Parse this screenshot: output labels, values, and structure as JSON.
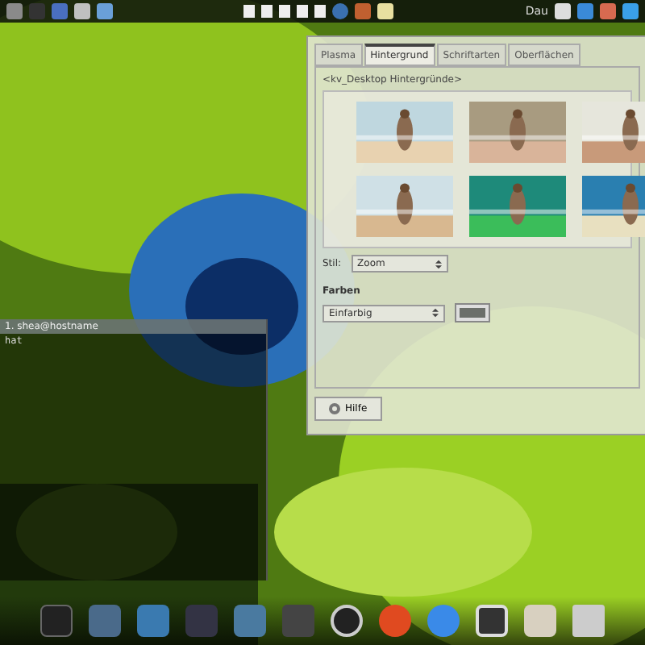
{
  "top_panel": {
    "label": "Dau"
  },
  "settings_window": {
    "tabs": [
      {
        "label": "Plasma",
        "selected": false
      },
      {
        "label": "Hintergrund",
        "selected": true
      },
      {
        "label": "Schriftarten",
        "selected": false
      },
      {
        "label": "Oberflächen",
        "selected": false
      }
    ],
    "group_title": "<kv_Desktop Hintergründe>",
    "style_label": "Stil:",
    "style_value": "Zoom",
    "colors_label": "Farben",
    "colors_value": "Einfarbig",
    "help_button": "Hilfe"
  },
  "terminal": {
    "title": "1. shea@hostname",
    "lines": [
      "hat"
    ]
  }
}
